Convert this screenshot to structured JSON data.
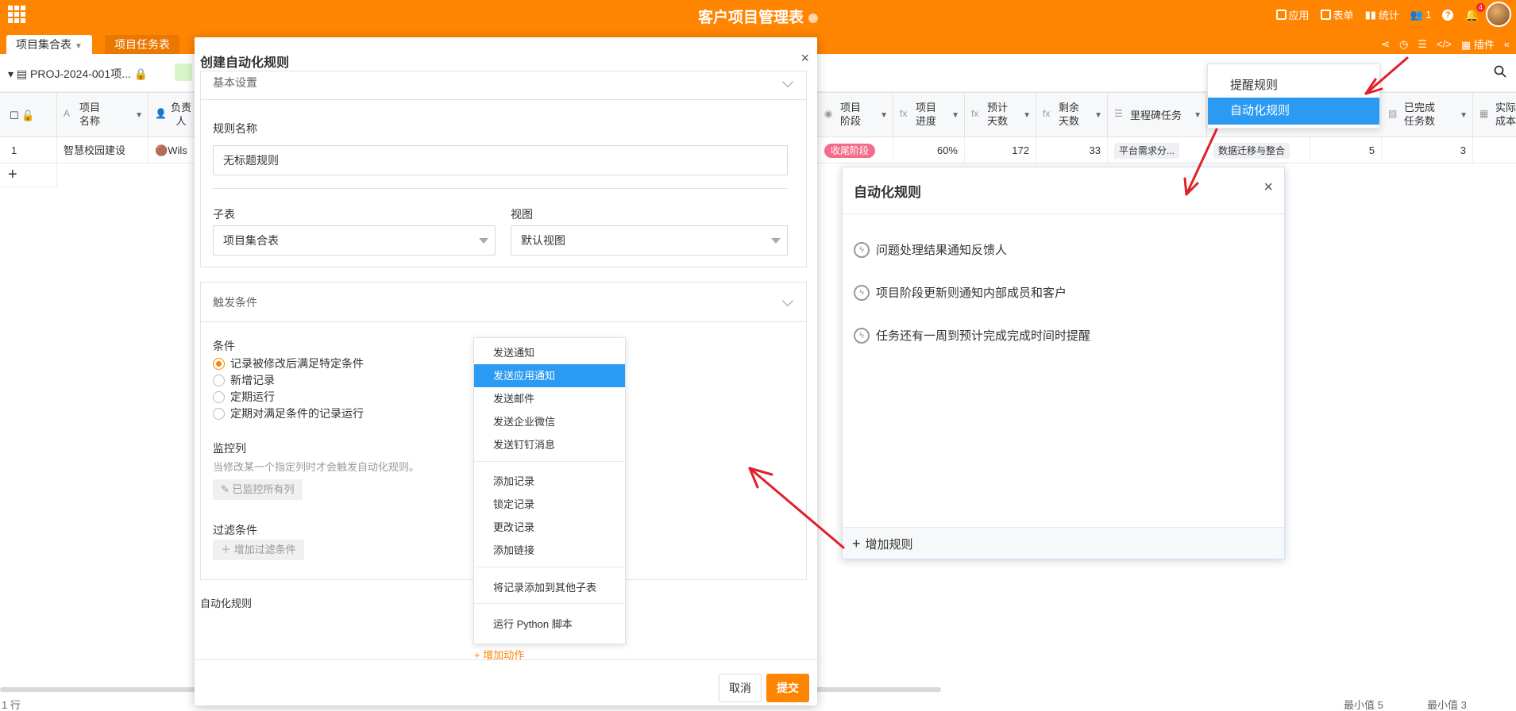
{
  "app": {
    "title": "客户项目管理表",
    "actions": {
      "apps": "应用",
      "form": "表单",
      "stats": "统计",
      "members": "1",
      "notify_badge": "4"
    }
  },
  "tabs": [
    "项目集合表",
    "项目任务表"
  ],
  "tab_right": {
    "plugins": "插件"
  },
  "toolbar": {
    "view_name": "PROJ-2024-001项..."
  },
  "grid": {
    "headers": {
      "name": "项目\n名称",
      "owner": "负责\n人",
      "stage": "项目\n阶段",
      "progress": "项目\n进度",
      "plan_days": "预计\n天数",
      "remain_days": "剩余\n天数",
      "milestone": "里程碑任务",
      "done_tasks": "已完成\n任务数",
      "actual": "实际\n成本"
    },
    "row": {
      "index": "1",
      "name": "智慧校园建设",
      "owner": "Wils",
      "stage": "收尾阶段",
      "progress": "60%",
      "plan_days": "172",
      "remain_days": "33",
      "milestone1": "平台需求分...",
      "milestone2": "数据迁移与整合",
      "col_a": "5",
      "done_tasks": "3"
    },
    "add_row": "+"
  },
  "status": {
    "rows": "1 行",
    "min1": "最小值 5",
    "min2": "最小值 3"
  },
  "dialog": {
    "title": "创建自动化规则",
    "close": "×",
    "basic_section": "基本设置",
    "rule_name_label": "规则名称",
    "rule_name_value": "无标题规则",
    "subtable_label": "子表",
    "subtable_value": "项目集合表",
    "view_label": "视图",
    "view_value": "默认视图",
    "trigger_section": "触发条件",
    "condition_label": "条件",
    "conditions": [
      "记录被修改后满足特定条件",
      "新增记录",
      "定期运行",
      "定期对满足条件的记录运行"
    ],
    "monitor_label": "监控列",
    "monitor_hint": "当修改某一个指定列时才会触发自动化规则。",
    "monitor_btn": "已监控所有列",
    "filter_label": "过滤条件",
    "filter_btn": "增加过滤条件",
    "auto_rule_label": "自动化规则",
    "add_action": "+ 增加动作",
    "cancel": "取消",
    "submit": "提交"
  },
  "action_menu": {
    "group1": [
      "发送通知",
      "发送应用通知",
      "发送邮件",
      "发送企业微信",
      "发送钉钉消息"
    ],
    "group2": [
      "添加记录",
      "锁定记录",
      "更改记录",
      "添加链接"
    ],
    "group3": [
      "将记录添加到其他子表"
    ],
    "group4": [
      "运行 Python 脚本"
    ],
    "highlighted": "发送应用通知"
  },
  "rules_panel": {
    "title": "自动化规则",
    "close": "×",
    "rules": [
      "问题处理结果通知反馈人",
      "项目阶段更新则通知内部成员和客户",
      "任务还有一周到预计完成完成时间时提醒"
    ],
    "add_rule": "增加规则"
  },
  "settings_menu": {
    "items": [
      "提醒规则",
      "自动化规则"
    ],
    "highlighted": "自动化规则"
  },
  "colors": {
    "brand": "#ff8400",
    "highlight": "#2b9af3",
    "arrow": "#e0202a"
  }
}
